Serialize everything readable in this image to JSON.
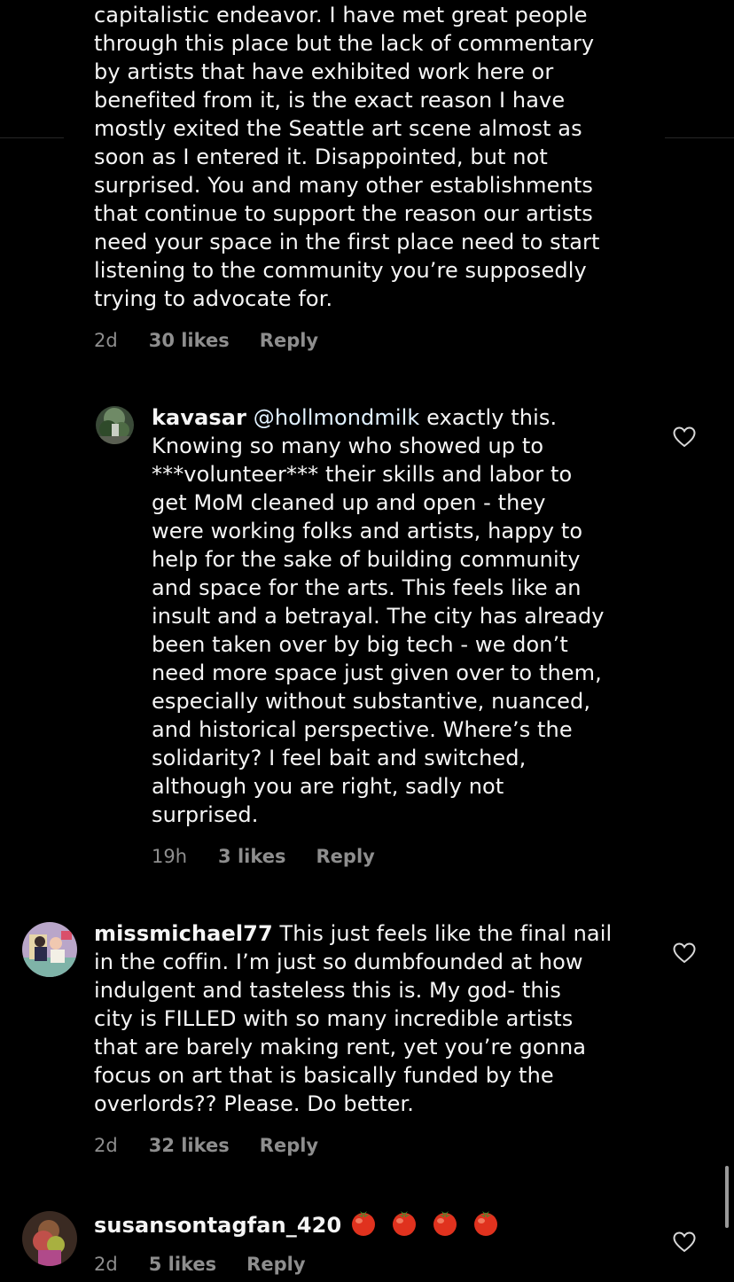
{
  "comment_1": {
    "lines": [
      "capitalistic endeavor. I have met great people",
      "through this place but the lack of commentary",
      "by artists that have exhibited work here or",
      "benefited from it, is the exact reason I have",
      "mostly exited the Seattle art scene almost as",
      "soon as I entered it. Disappointed, but not",
      "surprised. You and many other establishments",
      "that continue to support the reason our artists",
      "need your space in the first place need to start",
      "listening to the community you’re supposedly",
      "trying to advocate for."
    ],
    "time": "2d",
    "likes": "30 likes",
    "reply": "Reply"
  },
  "comment_2": {
    "username": "kavasar",
    "mention": "@hollmondmilk",
    "first_line_rest": " exactly this.",
    "lines": [
      "Knowing so many  who showed up to",
      "***volunteer*** their skills and labor to",
      "get MoM cleaned up and open - they",
      "were working folks and artists, happy to",
      "help for the sake of building community",
      "and space for the arts. This feels like an",
      "insult and a betrayal. The city has already",
      "been taken over by big tech - we don’t",
      "need more space just given over to them,",
      "especially without substantive, nuanced,",
      "and historical perspective. Where’s the",
      "solidarity? I feel bait and switched,",
      "although you are right, sadly not",
      "surprised."
    ],
    "time": "19h",
    "likes": "3 likes",
    "reply": "Reply"
  },
  "comment_3": {
    "username": "missmichael77",
    "first_line_rest": " This just feels like the final nail",
    "lines": [
      "in the coffin.  I’m just so dumbfounded at how",
      "indulgent and tasteless this is.  My god- this",
      "city is FILLED with so many incredible artists",
      "that are barely making rent, yet you’re gonna",
      "focus on art that is basically funded by the",
      "overlords?? Please.  Do better."
    ],
    "time": "2d",
    "likes": "32 likes",
    "reply": "Reply"
  },
  "comment_4": {
    "username": "susansontagfan_420",
    "emoji_count": 4,
    "time": "2d",
    "likes": "5 likes",
    "reply": "Reply"
  },
  "colors": {
    "background": "#000000",
    "text": "#f5f5f5",
    "meta": "#8e8e8e",
    "tomato": "#e0321e"
  },
  "icons": [
    "heart-icon",
    "tomato-emoji"
  ]
}
